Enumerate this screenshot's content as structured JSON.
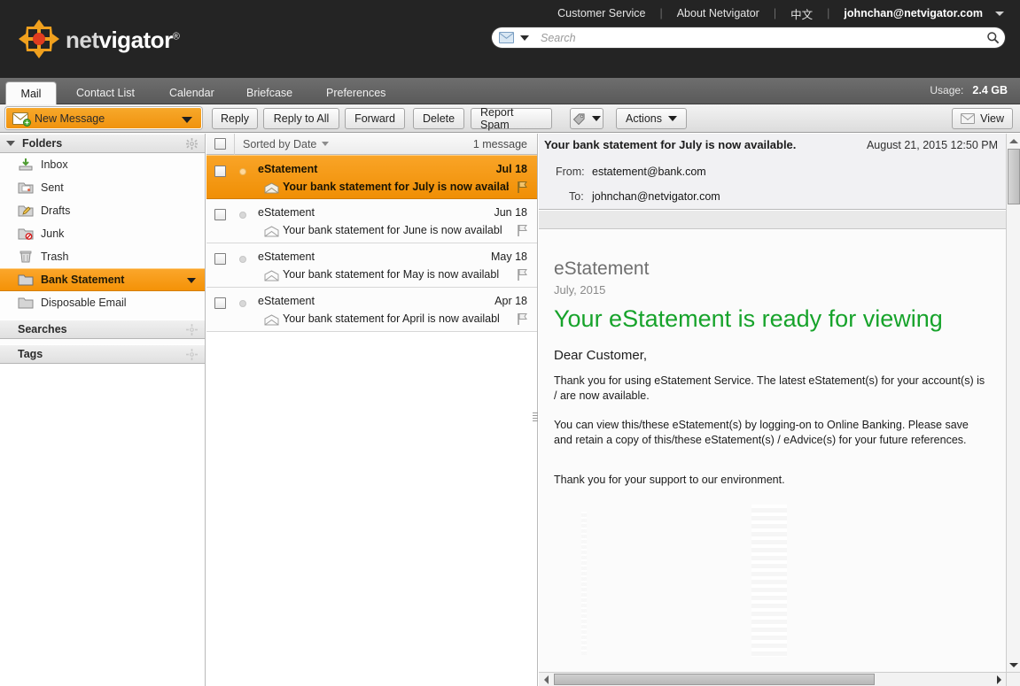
{
  "brand": {
    "name_prefix": "net",
    "name_suffix": "vigator",
    "registered": "®",
    "logo_icon": "compass-arrows-icon",
    "accent_orange": "#f49207",
    "dark_bar": "#242424"
  },
  "topnav": {
    "links": [
      {
        "label": "Customer Service",
        "name": "customer-service-link"
      },
      {
        "label": "About Netvigator",
        "name": "about-netvigator-link"
      },
      {
        "label": "中文",
        "name": "chinese-language-link"
      }
    ],
    "separator": "|",
    "account_email": "johnchan@netvigator.com",
    "account_caret_icon": "chevron-down-icon"
  },
  "search": {
    "scope_icon": "mail-icon",
    "scope_caret_icon": "chevron-down-icon",
    "placeholder": "Search",
    "value": "",
    "go_icon": "search-icon"
  },
  "tabs": [
    {
      "label": "Mail",
      "active": true
    },
    {
      "label": "Contact List",
      "active": false
    },
    {
      "label": "Calendar",
      "active": false
    },
    {
      "label": "Briefcase",
      "active": false
    },
    {
      "label": "Preferences",
      "active": false
    }
  ],
  "usage": {
    "label": "Usage:",
    "value": "2.4 GB"
  },
  "toolbar": {
    "new_message": {
      "label": "New Message",
      "icon": "new-mail-icon",
      "caret_icon": "chevron-down-icon"
    },
    "reply": "Reply",
    "reply_all": "Reply to All",
    "forward": "Forward",
    "delete": "Delete",
    "report_spam": "Report Spam",
    "tag": {
      "icon": "tag-icon",
      "caret_icon": "chevron-down-icon"
    },
    "actions": "Actions",
    "view": {
      "label": "View",
      "icon": "mail-icon",
      "caret_icon": "chevron-down-icon"
    }
  },
  "sidebar": {
    "sections": [
      {
        "title": "Folders",
        "name": "folders-section",
        "gear_icon": "gear-icon",
        "expand_icon": "triangle-down-icon"
      },
      {
        "title": "Searches",
        "name": "searches-section",
        "gear_icon": "gear-icon"
      },
      {
        "title": "Tags",
        "name": "tags-section",
        "gear_icon": "gear-icon"
      }
    ],
    "folders": [
      {
        "label": "Inbox",
        "icon": "inbox-icon",
        "selected": false
      },
      {
        "label": "Sent",
        "icon": "sent-folder-icon",
        "selected": false
      },
      {
        "label": "Drafts",
        "icon": "drafts-folder-icon",
        "selected": false
      },
      {
        "label": "Junk",
        "icon": "junk-folder-icon",
        "selected": false
      },
      {
        "label": "Trash",
        "icon": "trash-icon",
        "selected": false
      },
      {
        "label": "Bank Statement",
        "icon": "folder-icon",
        "selected": true,
        "caret_icon": "chevron-down-icon"
      },
      {
        "label": "Disposable Email",
        "icon": "folder-icon",
        "selected": false
      }
    ]
  },
  "message_list": {
    "select_all_checkbox": "select-all-checkbox",
    "sort_label": "Sorted by Date",
    "sort_caret_icon": "triangle-down-icon",
    "count_label": "1 message",
    "rows": [
      {
        "from": "eStatement",
        "date": "Jul 18",
        "subject": "Your bank statement for July is now availabl",
        "selected": true,
        "envelope_icon": "envelope-open-icon",
        "flag_icon": "flag-icon",
        "status_icon": "unread-dot-icon"
      },
      {
        "from": "eStatement",
        "date": "Jun 18",
        "subject": "Your bank statement for June is now availabl",
        "selected": false,
        "envelope_icon": "envelope-open-icon",
        "flag_icon": "flag-icon",
        "status_icon": "unread-dot-icon"
      },
      {
        "from": "eStatement",
        "date": "May 18",
        "subject": "Your bank statement for May is now availabl",
        "selected": false,
        "envelope_icon": "envelope-open-icon",
        "flag_icon": "flag-icon",
        "status_icon": "unread-dot-icon"
      },
      {
        "from": "eStatement",
        "date": "Apr 18",
        "subject": "Your bank statement for April is now availabl",
        "selected": false,
        "envelope_icon": "envelope-open-icon",
        "flag_icon": "flag-icon",
        "status_icon": "unread-dot-icon"
      }
    ]
  },
  "reader": {
    "subject": "Your bank statement for July is now available.",
    "date": "August 21, 2015 12:50 PM",
    "from_label": "From:",
    "from_value": "estatement@bank.com",
    "to_label": "To:",
    "to_value": "johnchan@netvigator.com",
    "body": {
      "header_title": "eStatement",
      "header_period": "July, 2015",
      "headline": "Your eStatement is ready for viewing",
      "salutation": "Dear Customer,",
      "paragraph_1": "Thank you for using eStatement Service. The latest eStatement(s) for your account(s) is / are now available.",
      "paragraph_2": "You can view this/these eStatement(s) by logging-on to Online Banking. Please save and retain a copy of this/these eStatement(s) / eAdvice(s) for your future references.",
      "paragraph_3": "Thank you for your support to our environment."
    }
  }
}
